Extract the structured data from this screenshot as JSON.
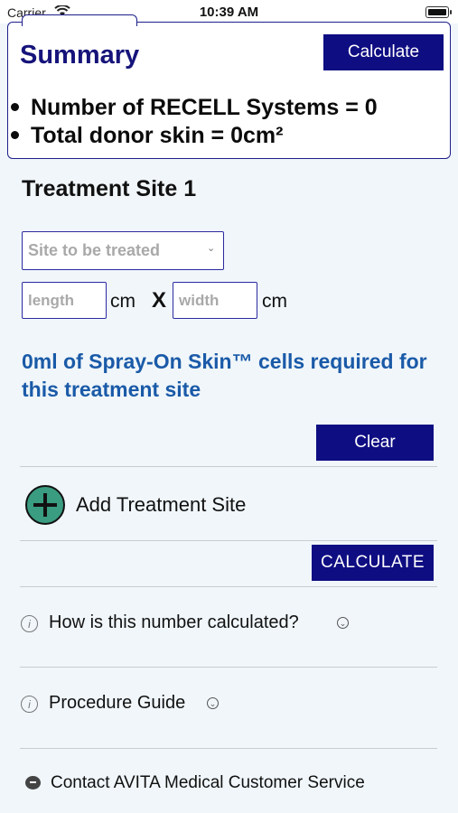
{
  "status_bar": {
    "carrier": "Carrier",
    "time": "10:39 AM"
  },
  "summary": {
    "title": "Summary",
    "calculate_label": "Calculate",
    "lines": [
      "Number of RECELL Systems = 0",
      "Total donor skin = 0cm²"
    ]
  },
  "treatment_site": {
    "title": "Treatment Site 1",
    "site_placeholder": "Site to be treated",
    "length_placeholder": "length",
    "width_placeholder": "width",
    "unit_cm": "cm",
    "times_symbol": "X",
    "required_text": "0ml of Spray-On Skin™ cells required for this treatment site",
    "clear_label": "Clear"
  },
  "add_site": {
    "label": "Add Treatment Site"
  },
  "calculate_label": "CALCULATE",
  "accordions": [
    {
      "label": "How is this number calculated?"
    },
    {
      "label": "Procedure Guide"
    }
  ],
  "contact": {
    "label": "Contact AVITA Medical Customer Service"
  },
  "colors": {
    "navy": "#0e0d82",
    "accent_blue": "#1a5aa8",
    "add_green": "#3a9c80",
    "background": "#f0f6fa"
  }
}
